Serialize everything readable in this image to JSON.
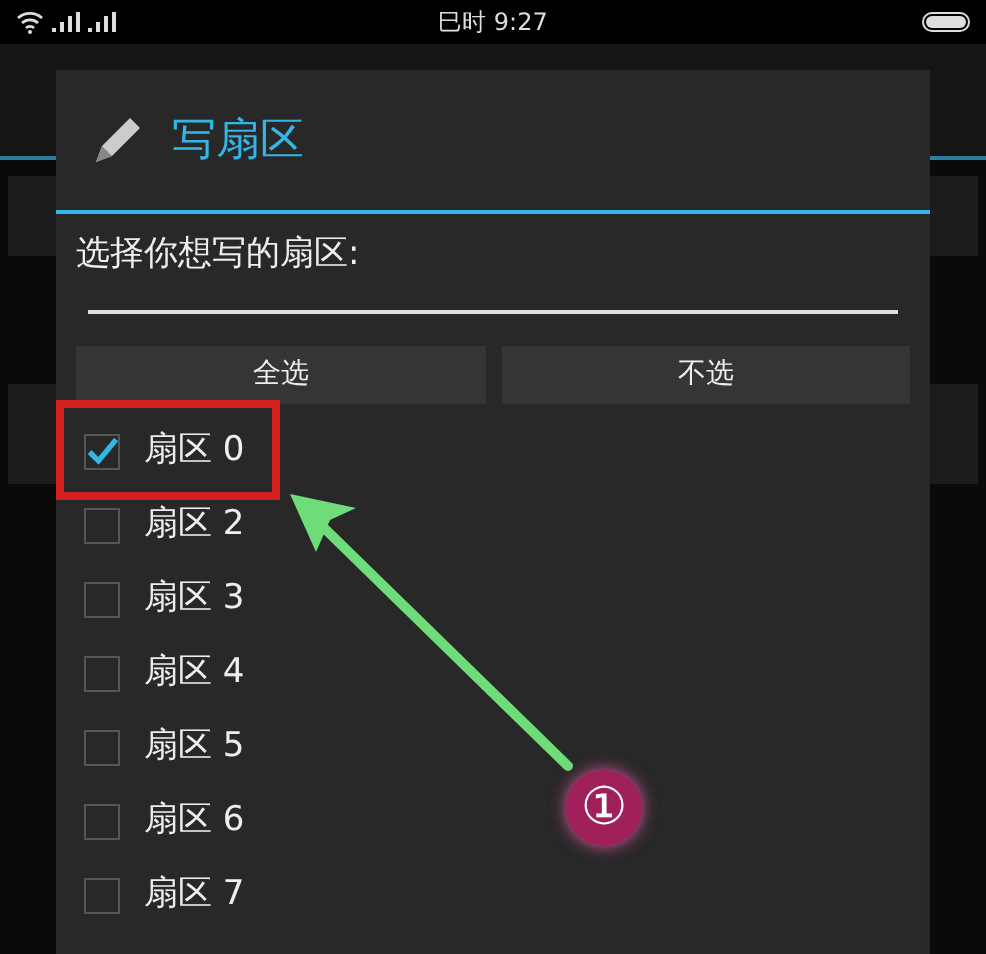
{
  "status_bar": {
    "time": "巳时 9:27"
  },
  "dialog": {
    "title": "写扇区",
    "prompt": "选择你想写的扇区:",
    "buttons": [
      {
        "label": "全选"
      },
      {
        "label": "不选"
      }
    ],
    "items": [
      {
        "label": "扇区 0",
        "checked": true
      },
      {
        "label": "扇区 2",
        "checked": false
      },
      {
        "label": "扇区 3",
        "checked": false
      },
      {
        "label": "扇区 4",
        "checked": false
      },
      {
        "label": "扇区 5",
        "checked": false
      },
      {
        "label": "扇区 6",
        "checked": false
      },
      {
        "label": "扇区 7",
        "checked": false
      }
    ]
  },
  "annotation": {
    "step": "①"
  }
}
